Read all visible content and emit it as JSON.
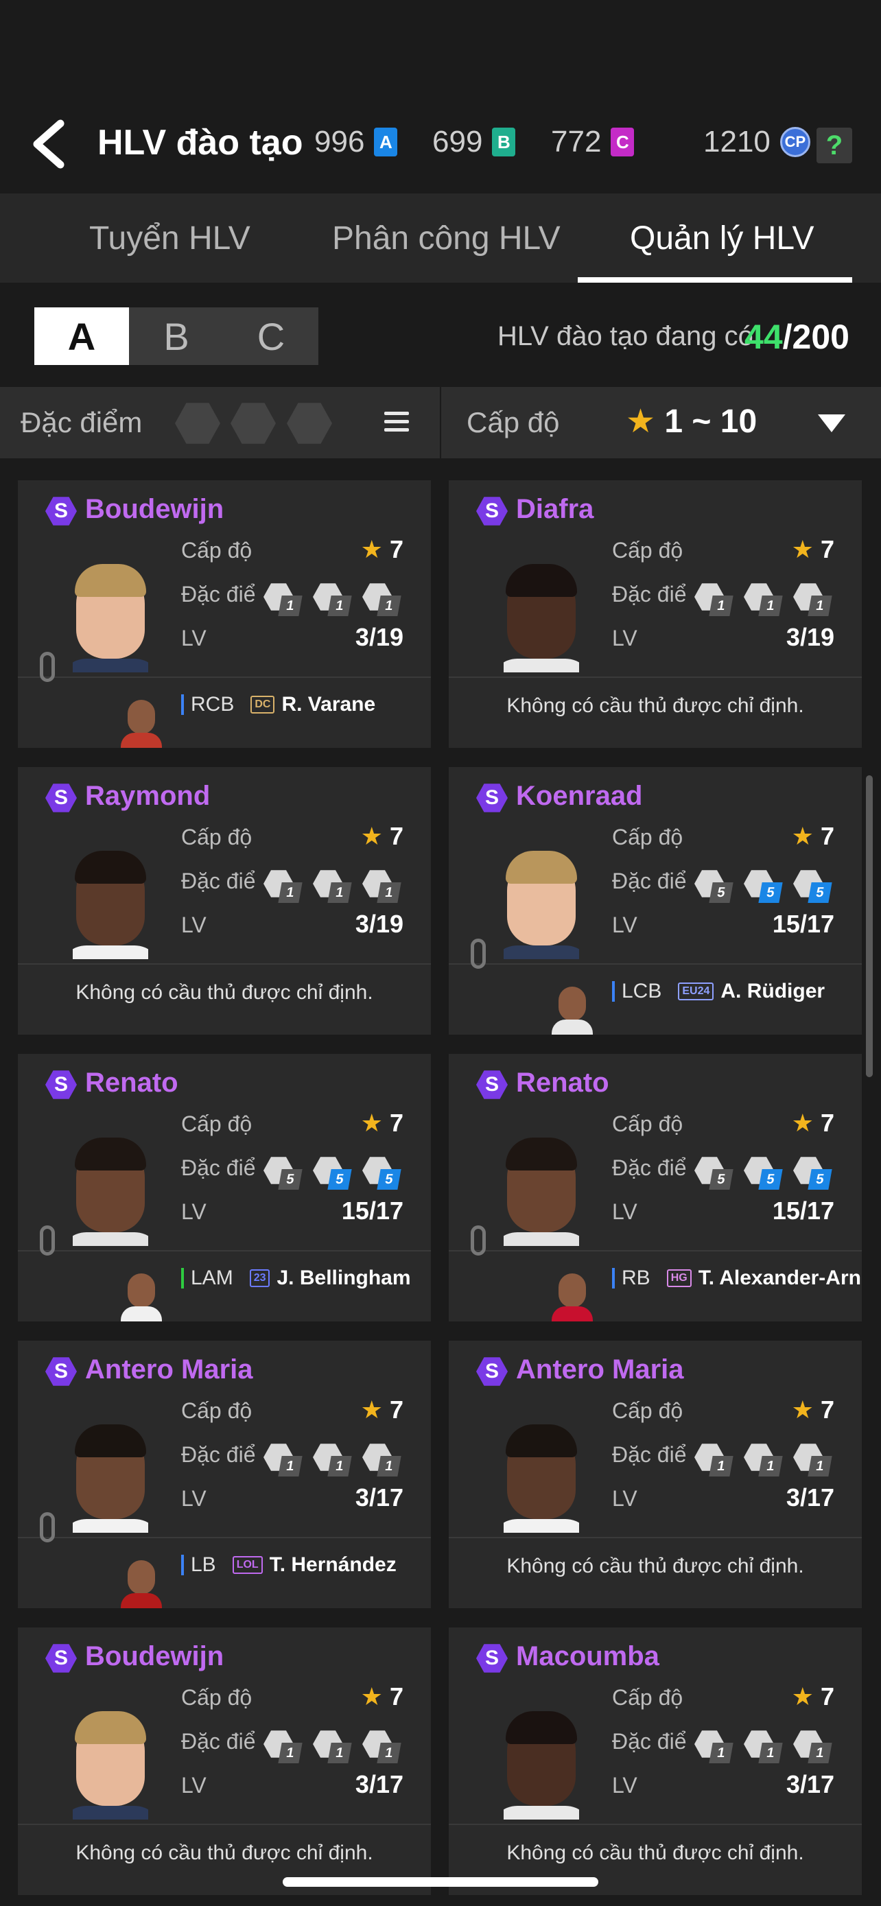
{
  "header": {
    "title": "HLV đào tạo",
    "currencies": [
      {
        "value": "996",
        "badge": "A",
        "color": "#1a86e6"
      },
      {
        "value": "699",
        "badge": "B",
        "color": "#1fae8e"
      },
      {
        "value": "772",
        "badge": "C",
        "color": "#c42bc7"
      }
    ],
    "cp": {
      "value": "1210",
      "badge": "CP"
    },
    "help": "?"
  },
  "tabs": [
    {
      "label": "Tuyển HLV",
      "active": false
    },
    {
      "label": "Phân công  HLV",
      "active": false
    },
    {
      "label": "Quản lý HLV",
      "active": true
    }
  ],
  "segments": [
    "A",
    "B",
    "C"
  ],
  "count": {
    "label": "HLV đào tạo đang có",
    "current": "44",
    "total": "/200"
  },
  "filter": {
    "trait_label": "Đặc điểm c",
    "level_label": "Cấp độ",
    "range_star": "★",
    "range": " 1 ~ 10"
  },
  "labels": {
    "level": "Cấp độ",
    "trait": "Đặc điểm",
    "lv": "LV",
    "none": "Không có cầu thủ được chỉ định.",
    "star": "★"
  },
  "cards": [
    {
      "name": "Boudewijn",
      "level": "7",
      "lv": "3/19",
      "traits": [
        "1",
        "1",
        "1"
      ],
      "blue": [
        false,
        false,
        false
      ],
      "assigned": {
        "pos": "RCB",
        "tag": "DC",
        "tag_color": "#d9b26a",
        "player": "R. Varane",
        "pos_color": "#3b82f6"
      }
    },
    {
      "name": "Diafra",
      "level": "7",
      "lv": "3/19",
      "traits": [
        "1",
        "1",
        "1"
      ],
      "blue": [
        false,
        false,
        false
      ],
      "assigned": null
    },
    {
      "name": "Raymond",
      "level": "7",
      "lv": "3/19",
      "traits": [
        "1",
        "1",
        "1"
      ],
      "blue": [
        false,
        false,
        false
      ],
      "assigned": null
    },
    {
      "name": "Koenraad",
      "level": "7",
      "lv": "15/17",
      "traits": [
        "5",
        "5",
        "5"
      ],
      "blue": [
        false,
        true,
        true
      ],
      "assigned": {
        "pos": "LCB",
        "tag": "EU24",
        "tag_color": "#8ea0ff",
        "player": "A. Rüdiger",
        "pos_color": "#3b82f6"
      }
    },
    {
      "name": "Renato",
      "level": "7",
      "lv": "15/17",
      "traits": [
        "5",
        "5",
        "5"
      ],
      "blue": [
        false,
        true,
        true
      ],
      "assigned": {
        "pos": "LAM",
        "tag": "23",
        "tag_color": "#6b7bff",
        "player": "J. Bellingham",
        "pos_color": "#2ecc40"
      }
    },
    {
      "name": "Renato",
      "level": "7",
      "lv": "15/17",
      "traits": [
        "5",
        "5",
        "5"
      ],
      "blue": [
        false,
        true,
        true
      ],
      "assigned": {
        "pos": "RB",
        "tag": "HG",
        "tag_color": "#d98ae8",
        "player": "T. Alexander-Arnold",
        "pos_color": "#3b82f6"
      }
    },
    {
      "name": "Antero Maria",
      "level": "7",
      "lv": "3/17",
      "traits": [
        "1",
        "1",
        "1"
      ],
      "blue": [
        false,
        false,
        false
      ],
      "assigned": {
        "pos": "LB",
        "tag": "LOL",
        "tag_color": "#c06af0",
        "player": "T. Hernández",
        "pos_color": "#3b82f6"
      }
    },
    {
      "name": "Antero Maria",
      "level": "7",
      "lv": "3/17",
      "traits": [
        "1",
        "1",
        "1"
      ],
      "blue": [
        false,
        false,
        false
      ],
      "assigned": null
    },
    {
      "name": "Boudewijn",
      "level": "7",
      "lv": "3/17",
      "traits": [
        "1",
        "1",
        "1"
      ],
      "blue": [
        false,
        false,
        false
      ],
      "assigned": null
    },
    {
      "name": "Macoumba",
      "level": "7",
      "lv": "3/17",
      "traits": [
        "1",
        "1",
        "1"
      ],
      "blue": [
        false,
        false,
        false
      ],
      "assigned": null
    }
  ]
}
